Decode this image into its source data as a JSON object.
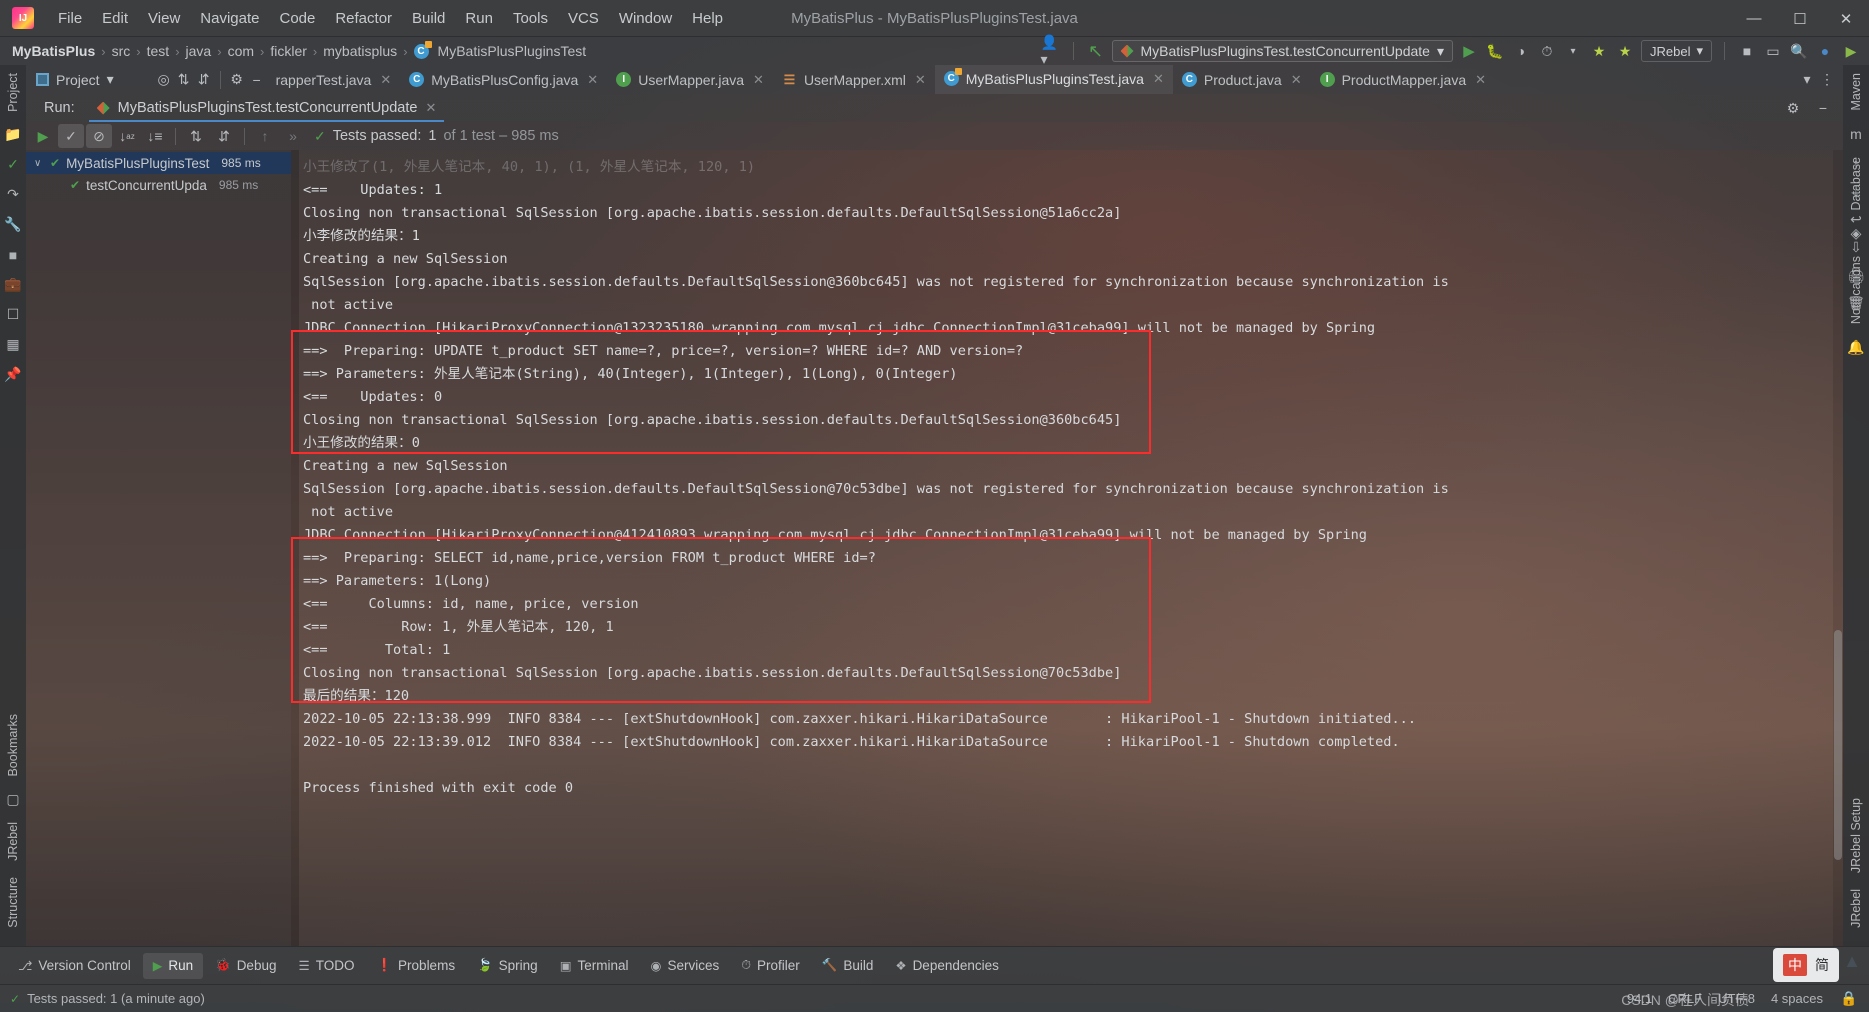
{
  "titlebar": {
    "logo_name": "intellij-logo",
    "menus": [
      "File",
      "Edit",
      "View",
      "Navigate",
      "Code",
      "Refactor",
      "Build",
      "Run",
      "Tools",
      "VCS",
      "Window",
      "Help"
    ],
    "window_title": "MyBatisPlus - MyBatisPlusPluginsTest.java",
    "minimize": "—",
    "maximize": "☐",
    "close": "✕"
  },
  "navbar": {
    "breadcrumbs": [
      "MyBatisPlus",
      "src",
      "test",
      "java",
      "com",
      "fickler",
      "mybatisplus",
      "MyBatisPlusPluginsTest"
    ],
    "separator": "›",
    "run_configuration": "MyBatisPlusPluginsTest.testConcurrentUpdate",
    "run_config_caret": "▾",
    "jrebel_label": "JRebel",
    "jrebel_caret": "▾",
    "toolbar_icons": [
      "run-icon",
      "debug-icon",
      "run-with-coverage-icon",
      "profiler-icon",
      "profiler-caret-icon",
      "jrebel-run-icon",
      "jrebel-debug-icon"
    ],
    "right_icons": [
      "stop-icon",
      "hide-icon",
      "search-icon",
      "account-icon",
      "updates-icon"
    ]
  },
  "editor_tabs": [
    {
      "label": "rapperTest.java",
      "icon": "class-file-icon",
      "icon_kind": "c",
      "active": false
    },
    {
      "label": "MyBatisPlusConfig.java",
      "icon": "class-file-icon",
      "icon_kind": "c",
      "active": false
    },
    {
      "label": "UserMapper.java",
      "icon": "interface-file-icon",
      "icon_kind": "i",
      "active": false
    },
    {
      "label": "UserMapper.xml",
      "icon": "xml-file-icon",
      "icon_kind": "xml",
      "active": false
    },
    {
      "label": "MyBatisPlusPluginsTest.java",
      "icon": "test-class-file-icon",
      "icon_kind": "ct",
      "active": true
    },
    {
      "label": "Product.java",
      "icon": "class-file-icon",
      "icon_kind": "c",
      "active": false
    },
    {
      "label": "ProductMapper.java",
      "icon": "interface-file-icon",
      "icon_kind": "i",
      "active": false
    }
  ],
  "project_toolbar": {
    "project_label": "Project",
    "caret": "▾",
    "icons": [
      "locate-icon",
      "expand-all-icon",
      "collapse-all-icon",
      "settings-gear-icon",
      "hide-icon"
    ]
  },
  "left_strip": {
    "top_label": "Project",
    "bottom_labels": [
      "Bookmarks",
      "JRebel",
      "Structure"
    ],
    "icons": [
      "project-icon",
      "commit-icon",
      "pull-requests-icon",
      "build-icon",
      "todo-icon",
      "problems-icon",
      "terminal-icon",
      "services-icon",
      "favorites-icon"
    ]
  },
  "right_strip": {
    "labels": [
      "Maven",
      "Database",
      "Notifications",
      "JRebel Setup",
      "JRebel"
    ],
    "icons": [
      "maven-icon",
      "database-icon",
      "notifications-icon"
    ]
  },
  "run_window": {
    "run_label": "Run:",
    "tab_title": "MyBatisPlusPluginsTest.testConcurrentUpdate",
    "tab_close": "✕",
    "header_icons": [
      "settings-gear-icon",
      "hide-window-icon"
    ],
    "toolbar_icons": [
      "rerun-icon",
      "show-passed-icon",
      "hide-ignored-icon",
      "sort-alphabetically-icon",
      "sort-by-duration-icon",
      "expand-all-icon",
      "collapse-all-icon",
      "previous-icon",
      "next-icon"
    ],
    "status_prefix": "Tests passed:",
    "status_count": "1",
    "status_suffix": "of 1 test – 985 ms"
  },
  "test_tree": [
    {
      "label": "MyBatisPlusPluginsTest",
      "duration": "985 ms",
      "selected": true,
      "indent": 0,
      "arrow": "∨"
    },
    {
      "label": "testConcurrentUpda",
      "duration": "985 ms",
      "selected": false,
      "indent": 1,
      "arrow": ""
    }
  ],
  "console": {
    "lines": [
      {
        "text": "小王修改了(1, 外星人笔记本, 40, 1), (1, 外星人笔记本, 120, 1)",
        "clipped": true
      },
      {
        "text": "<==    Updates: 1"
      },
      {
        "text": "Closing non transactional SqlSession [org.apache.ibatis.session.defaults.DefaultSqlSession@51a6cc2a]"
      },
      {
        "text": "小李修改的结果：1"
      },
      {
        "text": "Creating a new SqlSession"
      },
      {
        "text": "SqlSession [org.apache.ibatis.session.defaults.DefaultSqlSession@360bc645] was not registered for synchronization because synchronization is"
      },
      {
        "text": " not active"
      },
      {
        "text": "JDBC Connection [HikariProxyConnection@1323235180 wrapping com.mysql.cj.jdbc.ConnectionImpl@31ceba99] will not be managed by Spring"
      },
      {
        "text": "==>  Preparing: UPDATE t_product SET name=?, price=?, version=? WHERE id=? AND version=?"
      },
      {
        "text": "==> Parameters: 外星人笔记本(String), 40(Integer), 1(Integer), 1(Long), 0(Integer)"
      },
      {
        "text": "<==    Updates: 0"
      },
      {
        "text": "Closing non transactional SqlSession [org.apache.ibatis.session.defaults.DefaultSqlSession@360bc645]"
      },
      {
        "text": "小王修改的结果：0"
      },
      {
        "text": "Creating a new SqlSession"
      },
      {
        "text": "SqlSession [org.apache.ibatis.session.defaults.DefaultSqlSession@70c53dbe] was not registered for synchronization because synchronization is"
      },
      {
        "text": " not active"
      },
      {
        "text": "JDBC Connection [HikariProxyConnection@412410893 wrapping com.mysql.cj.jdbc.ConnectionImpl@31ceba99] will not be managed by Spring"
      },
      {
        "text": "==>  Preparing: SELECT id,name,price,version FROM t_product WHERE id=?"
      },
      {
        "text": "==> Parameters: 1(Long)"
      },
      {
        "text": "<==     Columns: id, name, price, version"
      },
      {
        "text": "<==         Row: 1, 外星人笔记本, 120, 1"
      },
      {
        "text": "<==       Total: 1"
      },
      {
        "text": "Closing non transactional SqlSession [org.apache.ibatis.session.defaults.DefaultSqlSession@70c53dbe]"
      },
      {
        "text": "最后的结果：120"
      },
      {
        "text": "2022-10-05 22:13:38.999  INFO 8384 --- [extShutdownHook] com.zaxxer.hikari.HikariDataSource       : HikariPool-1 - Shutdown initiated..."
      },
      {
        "text": "2022-10-05 22:13:39.012  INFO 8384 --- [extShutdownHook] com.zaxxer.hikari.HikariDataSource       : HikariPool-1 - Shutdown completed."
      },
      {
        "text": ""
      },
      {
        "text": "Process finished with exit code 0"
      }
    ],
    "annotation_color": "#fc2c2c",
    "annotations": [
      {
        "name": "update-sql-highlight",
        "top": 1,
        "left": 0,
        "width": 0,
        "height": 0
      }
    ]
  },
  "bottom_bar": [
    {
      "label": "Version Control",
      "icon": "version-control-icon",
      "active": false
    },
    {
      "label": "Run",
      "icon": "run-icon",
      "active": true
    },
    {
      "label": "Debug",
      "icon": "debug-icon",
      "active": false
    },
    {
      "label": "TODO",
      "icon": "todo-icon",
      "active": false
    },
    {
      "label": "Problems",
      "icon": "problems-icon",
      "active": false
    },
    {
      "label": "Spring",
      "icon": "spring-icon",
      "active": false
    },
    {
      "label": "Terminal",
      "icon": "terminal-icon",
      "active": false
    },
    {
      "label": "Services",
      "icon": "services-icon",
      "active": false
    },
    {
      "label": "Profiler",
      "icon": "profiler-icon",
      "active": false
    },
    {
      "label": "Build",
      "icon": "build-icon",
      "active": false
    },
    {
      "label": "Dependencies",
      "icon": "dependencies-icon",
      "active": false
    }
  ],
  "status_bar": {
    "message": "Tests passed: 1 (a minute ago)",
    "caret_position": "94:1",
    "line_separator": "CRLF",
    "encoding": "UTF-8",
    "indent": "4 spaces",
    "ime_char": "中",
    "ime_char2": "简",
    "watermark": "CSDN @在人间负债"
  }
}
